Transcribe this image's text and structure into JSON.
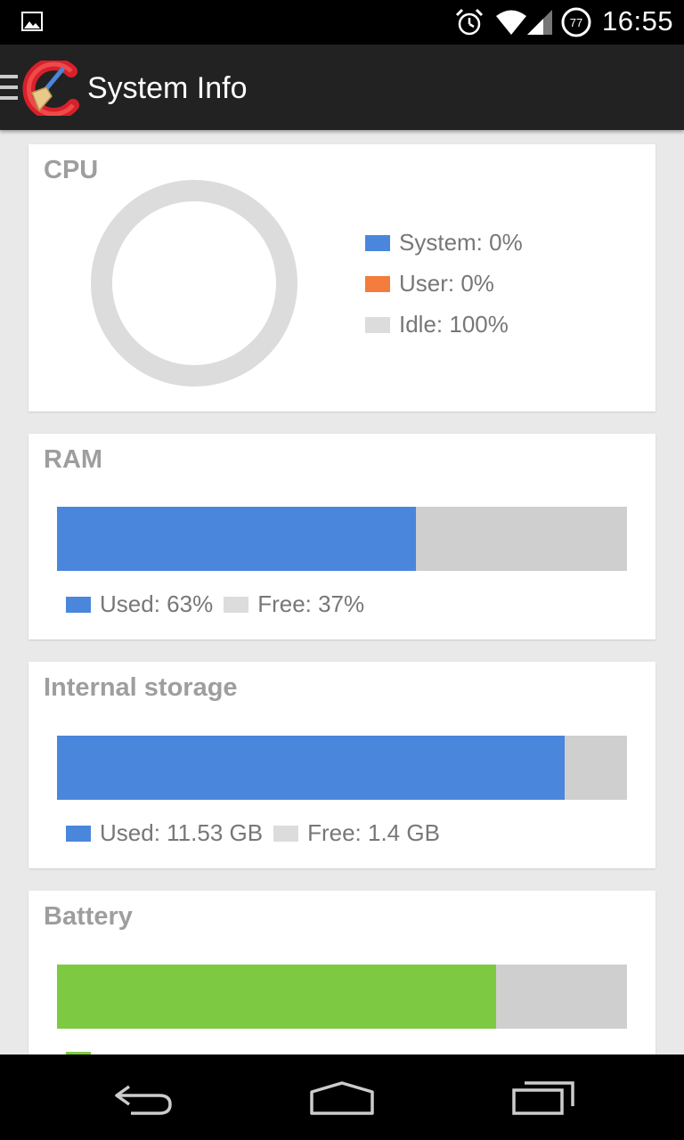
{
  "status_bar": {
    "time": "16:55",
    "battery_level": "77",
    "icons": [
      "gallery-icon",
      "alarm-icon",
      "wifi-icon",
      "signal-icon",
      "battery-icon"
    ]
  },
  "app_bar": {
    "title": "System Info",
    "icons": [
      "menu-icon",
      "ccleaner-logo-icon"
    ]
  },
  "colors": {
    "used_blue": "#4a86dc",
    "user_orange": "#f47c3c",
    "free_grey": "#cfcfcf",
    "battery_green": "#7dc942"
  },
  "cpu": {
    "title": "CPU",
    "system_label": "System: 0%",
    "user_label": "User: 0%",
    "idle_label": "Idle: 100%",
    "system_pct": 0,
    "user_pct": 0,
    "idle_pct": 100
  },
  "ram": {
    "title": "RAM",
    "used_fraction": 0.63,
    "used_label": "Used: 63%",
    "free_label": "Free: 37%"
  },
  "storage": {
    "title": "Internal storage",
    "used_fraction": 0.89,
    "used_label": "Used: 11.53 GB",
    "free_label": "Free: 1.4 GB"
  },
  "battery": {
    "title": "Battery",
    "level_fraction": 0.77
  },
  "nav_bar": {
    "icons": [
      "back-icon",
      "home-icon",
      "recent-apps-icon"
    ]
  }
}
